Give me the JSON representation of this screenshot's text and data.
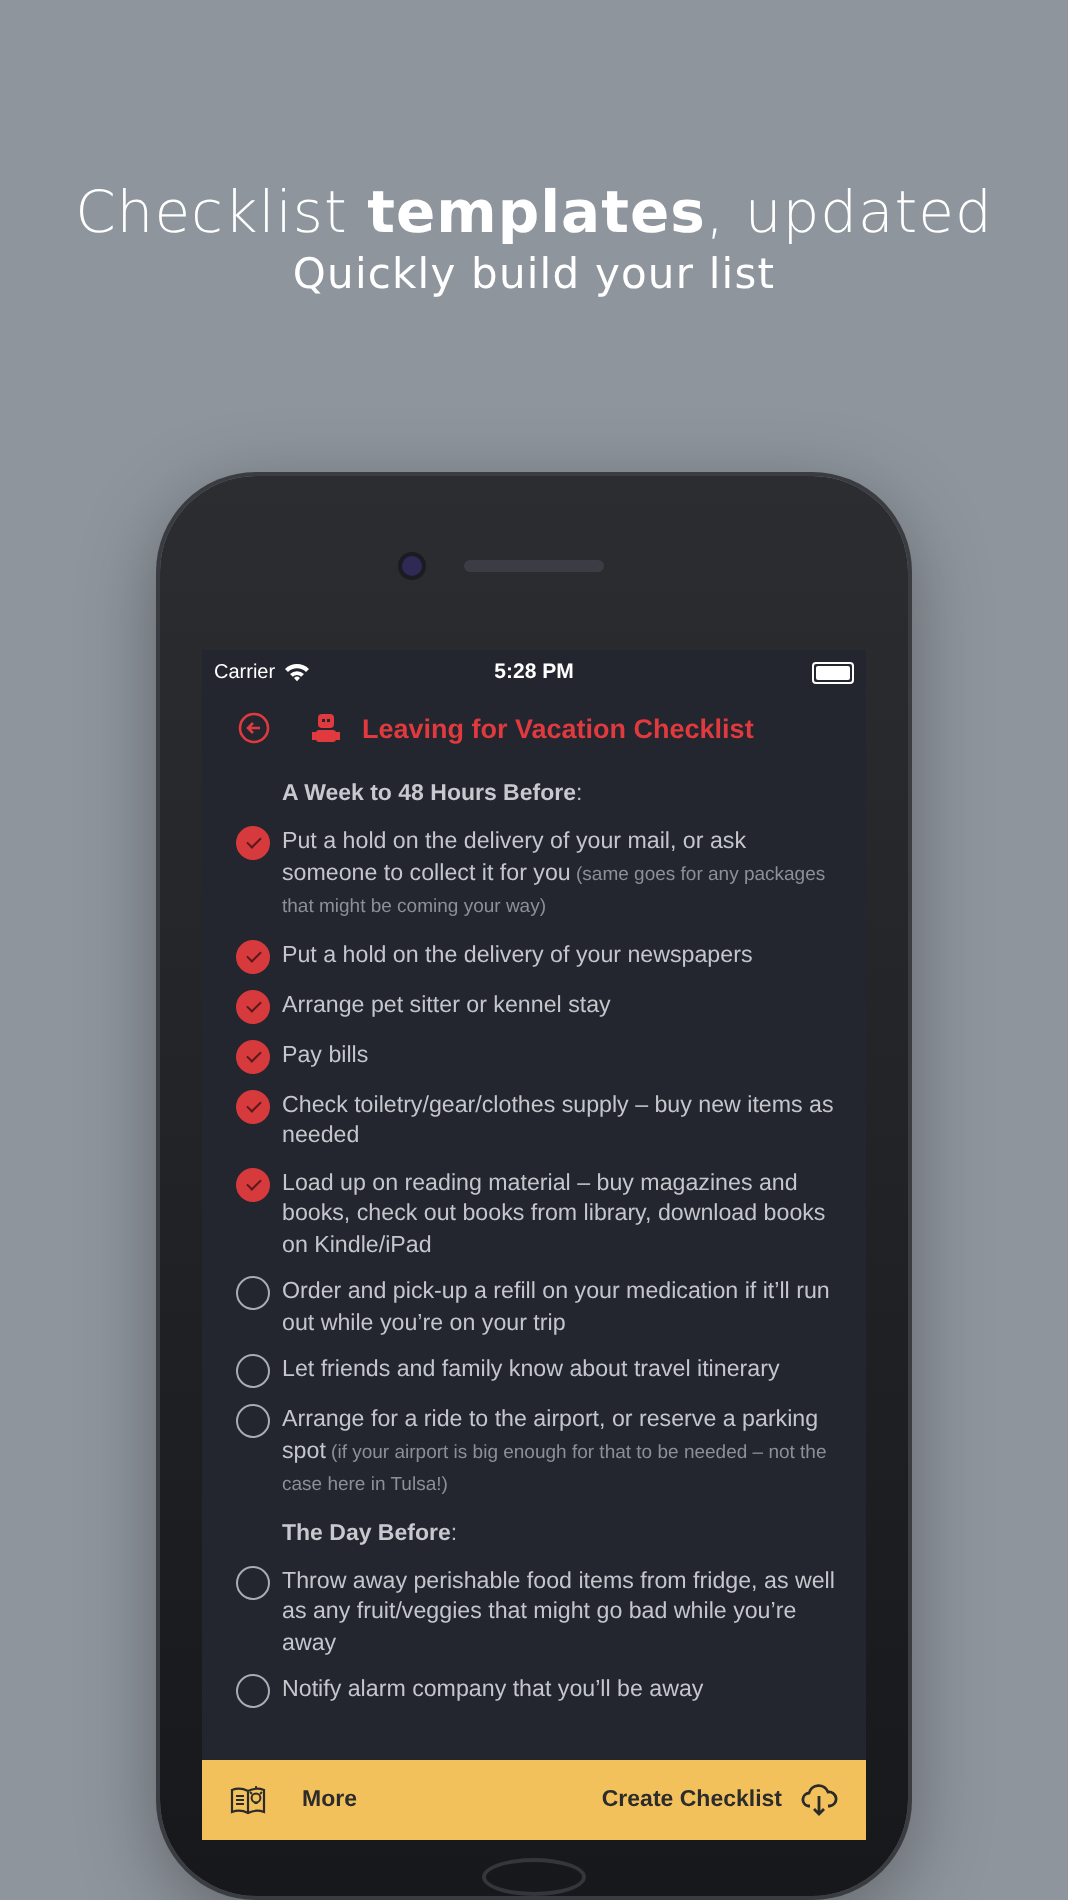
{
  "promo": {
    "headline": "Checklist **templates**, updated",
    "subtitle": "Quickly build your list"
  },
  "status_bar": {
    "carrier": "Carrier",
    "time": "5:28 PM"
  },
  "nav": {
    "title": "Leaving for Vacation Checklist"
  },
  "sections": [
    {
      "heading": "**A Week to 48 Hours Before**:",
      "items": [
        {
          "text": "Put a hold on the delivery of your mail, or ask someone to collect it for you",
          "note": "(same goes for any packages that might be coming your way)",
          "checked": true
        },
        {
          "text": "Put a hold on the delivery of your newspapers",
          "checked": true
        },
        {
          "text": "Arrange pet sitter or kennel stay",
          "checked": true
        },
        {
          "text": "Pay bills",
          "checked": true
        },
        {
          "text": "Check toiletry/gear/clothes supply – buy new items as needed",
          "checked": true
        },
        {
          "text": "Load up on reading material – buy magazines and books, check out books from library, download books on Kindle/iPad",
          "checked": true
        },
        {
          "text": "Order and pick-up a refill on your medication if it’ll run out while you’re on your trip",
          "checked": false
        },
        {
          "text": "Let friends and family know about travel itinerary",
          "checked": false
        },
        {
          "text": "Arrange for a ride to the airport, or reserve a parking spot",
          "note": "(if your airport is big enough for that to be needed – not the case here in Tulsa!)",
          "checked": false
        }
      ]
    },
    {
      "heading": "**The Day Before**:",
      "items": [
        {
          "text": "Throw away perishable food items from fridge, as well as any fruit/veggies that might go bad while you’re away",
          "checked": false
        },
        {
          "text": "Notify alarm company that you’ll be away",
          "checked": false
        }
      ]
    }
  ],
  "toolbar": {
    "more": "More",
    "create": "Create Checklist"
  }
}
